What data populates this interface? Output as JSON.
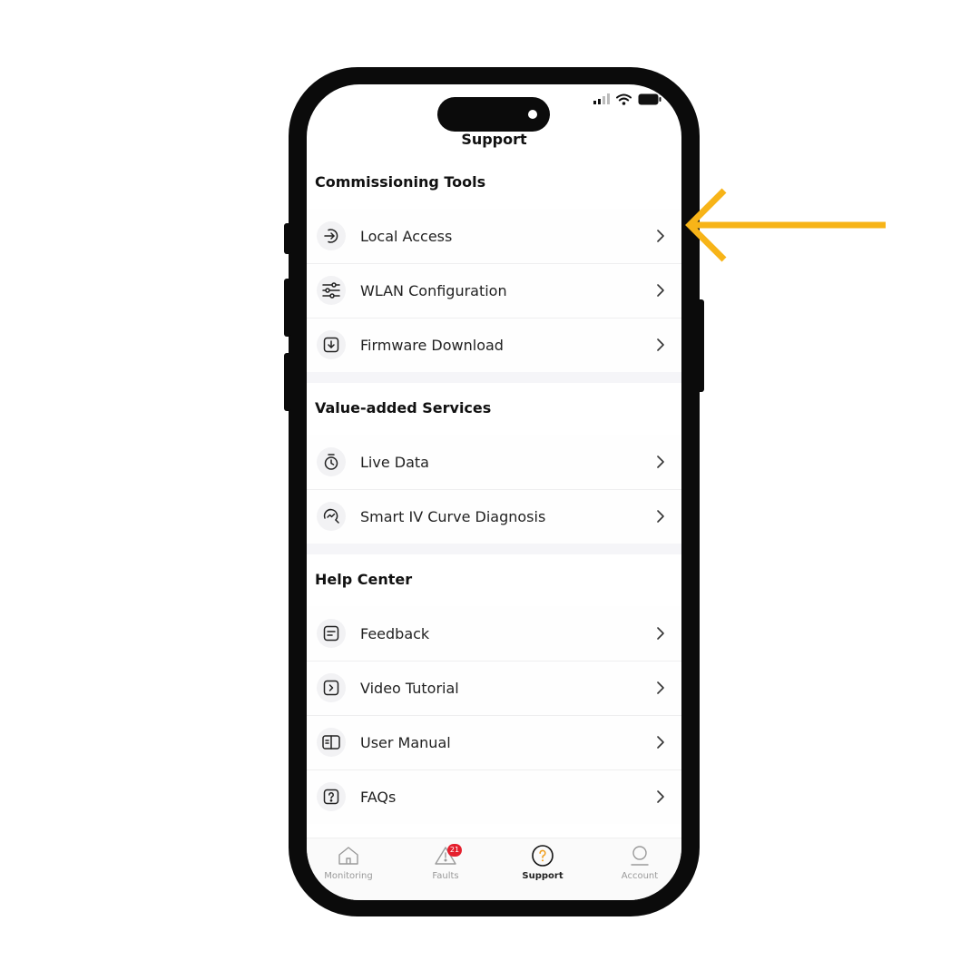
{
  "header": {
    "title": "Support"
  },
  "sections": [
    {
      "title": "Commissioning Tools",
      "items": [
        {
          "label": "Local Access",
          "icon": "login-arrow-icon"
        },
        {
          "label": "WLAN Configuration",
          "icon": "sliders-icon"
        },
        {
          "label": "Firmware Download",
          "icon": "download-box-icon"
        }
      ]
    },
    {
      "title": "Value-added Services",
      "items": [
        {
          "label": "Live Data",
          "icon": "stopwatch-icon"
        },
        {
          "label": "Smart IV Curve Diagnosis",
          "icon": "curve-search-icon"
        }
      ]
    },
    {
      "title": "Help Center",
      "items": [
        {
          "label": "Feedback",
          "icon": "feedback-note-icon"
        },
        {
          "label": "Video Tutorial",
          "icon": "video-play-icon"
        },
        {
          "label": "User Manual",
          "icon": "book-icon"
        },
        {
          "label": "FAQs",
          "icon": "faq-question-icon"
        }
      ]
    }
  ],
  "tabbar": {
    "tabs": [
      {
        "label": "Monitoring",
        "icon": "home-icon",
        "active": false
      },
      {
        "label": "Faults",
        "icon": "warning-icon",
        "badge": "21",
        "active": false
      },
      {
        "label": "Support",
        "icon": "help-circle-icon",
        "active": true
      },
      {
        "label": "Account",
        "icon": "user-icon",
        "active": false
      }
    ]
  },
  "colors": {
    "accent": "#F7B418",
    "badge": "#E5202E",
    "active_tab_icon": "#F0A020"
  }
}
